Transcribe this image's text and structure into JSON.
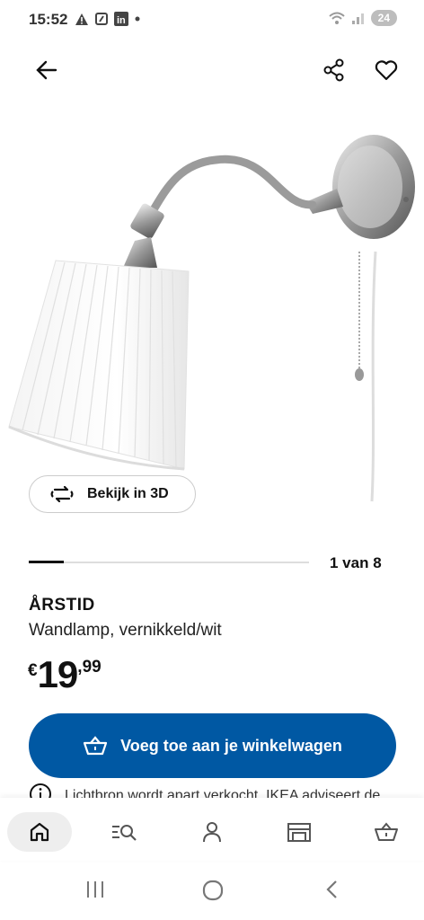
{
  "status_bar": {
    "time": "15:52",
    "battery": "24"
  },
  "actions": {
    "back": "back",
    "share": "share",
    "favorite": "favorite"
  },
  "viewer": {
    "label": "Bekijk in 3D"
  },
  "gallery": {
    "counter": "1 van 8",
    "current": 1,
    "total": 8
  },
  "product": {
    "name": "ÅRSTID",
    "description": "Wandlamp, vernikkeld/wit",
    "price": {
      "currency": "€",
      "integer": "19",
      "decimal": ",99"
    }
  },
  "cart_button": {
    "label": "Voeg toe aan je winkelwagen"
  },
  "notice": {
    "text": "Lichtbron wordt apart verkocht. IKEA adviseert de"
  },
  "bottom_nav": {
    "items": [
      "home",
      "search",
      "account",
      "store",
      "cart"
    ],
    "active": "home"
  },
  "colors": {
    "primary": "#0058a3",
    "text": "#111111"
  }
}
